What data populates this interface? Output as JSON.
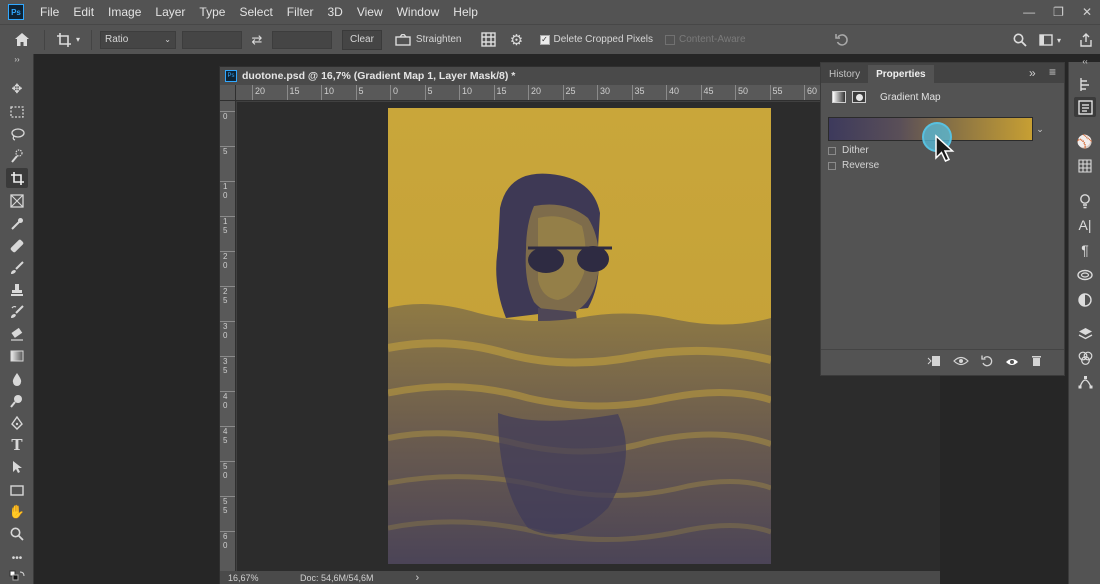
{
  "app": {
    "logo_text": "Ps",
    "window_controls": [
      "—",
      "❐",
      "✕"
    ]
  },
  "menubar": {
    "items": [
      "File",
      "Edit",
      "Image",
      "Layer",
      "Type",
      "Select",
      "Filter",
      "3D",
      "View",
      "Window",
      "Help"
    ]
  },
  "options_bar": {
    "ratio_select": "Ratio",
    "swap_icon": "swap-arrows",
    "clear_label": "Clear",
    "straighten_label": "Straighten",
    "delete_cropped_label": "Delete Cropped Pixels",
    "delete_cropped_checked": true,
    "content_aware_label": "Content-Aware",
    "content_aware_checked": false
  },
  "document": {
    "tab_logo": "Ps",
    "title": "duotone.psd @ 16,7% (Gradient Map 1, Layer Mask/8) *",
    "ruler_h_labels": [
      "20",
      "15",
      "10",
      "5",
      "0",
      "5",
      "10",
      "15",
      "20",
      "25",
      "30",
      "35",
      "40",
      "45",
      "50",
      "55",
      "60"
    ],
    "ruler_v_labels": [
      "0",
      "5",
      "10",
      "15",
      "20",
      "25",
      "30",
      "35",
      "40",
      "45",
      "50",
      "55",
      "60"
    ],
    "zoom": "16,67%",
    "doc_info": "Doc: 54,6M/54,6M",
    "status_arrow": "›"
  },
  "properties_panel": {
    "tabs": [
      {
        "label": "History",
        "active": false
      },
      {
        "label": "Properties",
        "active": true
      }
    ],
    "adjustment_name": "Gradient Map",
    "gradient": {
      "start_color": "#3d3a5c",
      "end_color": "#c79f33"
    },
    "options": [
      {
        "label": "Dither",
        "checked": false
      },
      {
        "label": "Reverse",
        "checked": false
      }
    ],
    "panel_menu_icons": [
      "»",
      "≡"
    ]
  },
  "colors": {
    "duotone_highlight": "#c6a43a",
    "duotone_shadow": "#3f3a5a",
    "ui_panel": "#535353",
    "cursor_highlight": "#58c1e0"
  }
}
